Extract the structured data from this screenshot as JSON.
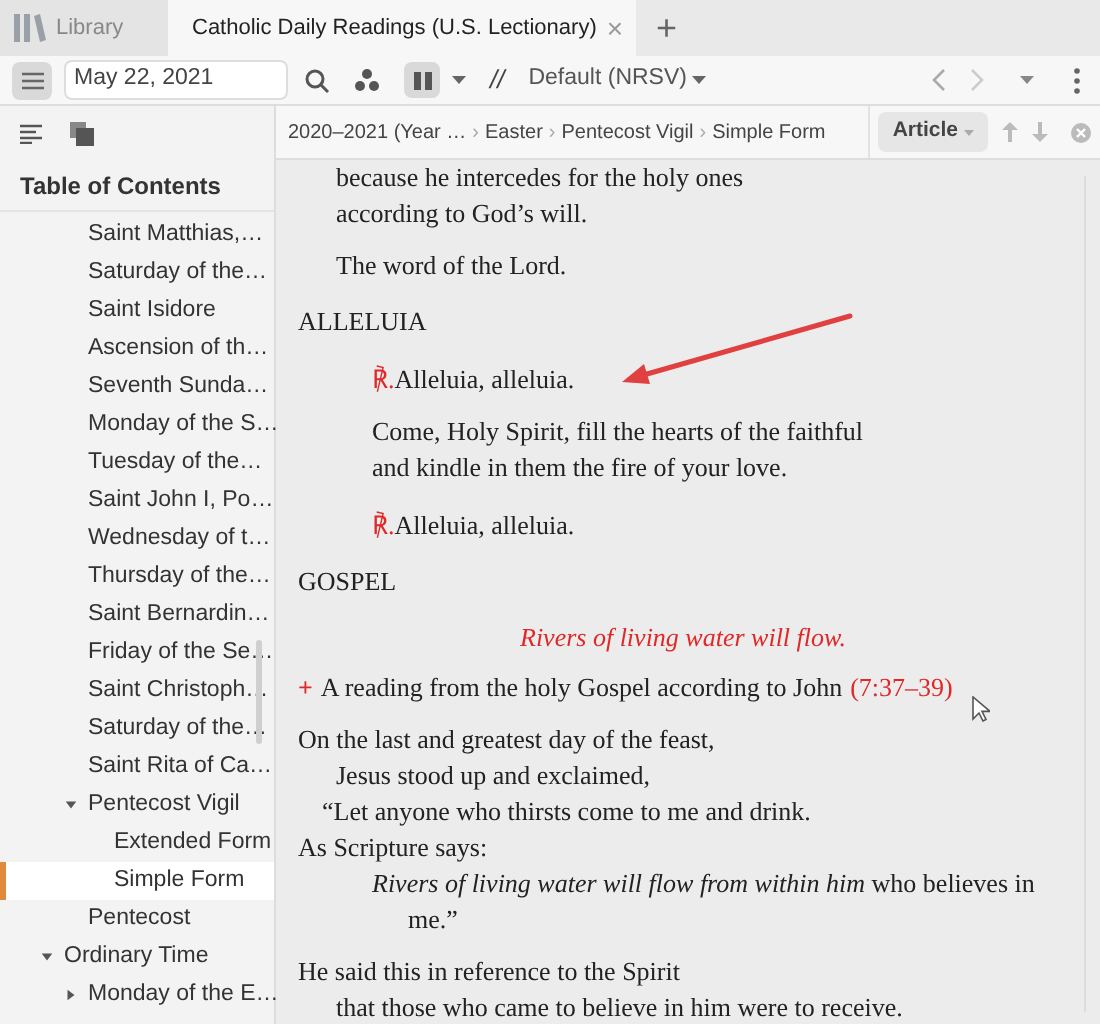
{
  "tabs": [
    {
      "label": "Library",
      "selected": false
    },
    {
      "label": "Catholic Daily Readings (U.S. Lectionary)",
      "selected": true,
      "close_glyph": "×"
    }
  ],
  "new_tab": "+",
  "toolbar": {
    "date": "May 22, 2021",
    "separator": "//",
    "version": "Default (NRSV)"
  },
  "breadcrumb": [
    {
      "label": "2020–2021 (Year …"
    },
    {
      "separator": "›",
      "label": "Easter"
    },
    {
      "separator": "›",
      "label": "Pentecost Vigil"
    },
    {
      "separator": "›",
      "label": "Simple Form"
    }
  ],
  "view_menu": "Article",
  "toc": {
    "title": "Table of Contents",
    "continued_items": [
      {
        "label": "Saint Matthias,…",
        "selected": false
      },
      {
        "label": "Saturday of the…",
        "selected": false
      },
      {
        "label": "Saint Isidore",
        "selected": false
      },
      {
        "label": "Ascension of th…",
        "selected": false
      },
      {
        "label": "Seventh Sunda…",
        "selected": false
      },
      {
        "label": "Monday of the S…",
        "selected": false
      },
      {
        "label": "Tuesday of the…",
        "selected": false
      },
      {
        "label": "Saint John I, Po…",
        "selected": false
      },
      {
        "label": "Wednesday of t…",
        "selected": false
      },
      {
        "label": "Thursday of the…",
        "selected": false
      },
      {
        "label": "Saint Bernardin…",
        "selected": false
      },
      {
        "label": "Friday of the Se…",
        "selected": false
      },
      {
        "label": "Saint Christoph…",
        "selected": false
      },
      {
        "label": "Saturday of the…",
        "selected": false
      },
      {
        "label": "Saint Rita of Ca…",
        "selected": false
      },
      {
        "label": "Pentecost Vigil",
        "selected": false,
        "expanded": true,
        "children": [
          {
            "label": "Extended Form",
            "selected": false
          },
          {
            "label": "Simple Form",
            "selected": true
          }
        ]
      },
      {
        "label": "Pentecost",
        "selected": false
      }
    ],
    "items": [
      {
        "label": "Ordinary Time",
        "selected": false,
        "expanded": true,
        "children": [
          {
            "label": "Monday of the E…",
            "selected": false,
            "expanded": false
          }
        ]
      }
    ]
  },
  "reading": [
    {
      "kind": "para",
      "lines": [
        {
          "kind": "indent",
          "text": "because he intercedes for the holy ones"
        },
        {
          "kind": "indent",
          "text": "according to God’s will."
        }
      ]
    },
    {
      "kind": "para",
      "lines": [
        {
          "kind": "indent",
          "text": "The word of the Lord."
        }
      ]
    },
    {
      "kind": "heading",
      "lines": [
        {
          "kind": "flush",
          "text": "ALLELUIA"
        }
      ]
    },
    {
      "kind": "response",
      "symbol": "℟.",
      "lines": [
        {
          "kind": "deep",
          "text": "Alleluia, alleluia."
        }
      ]
    },
    {
      "kind": "para",
      "lines": [
        {
          "kind": "deep",
          "text": "Come, Holy Spirit, fill the hearts of the faithful"
        },
        {
          "kind": "deep",
          "text": "and kindle in them the fire of your love."
        }
      ]
    },
    {
      "kind": "response",
      "symbol": "℟.",
      "lines": [
        {
          "kind": "deep",
          "text": "Alleluia, alleluia."
        }
      ]
    },
    {
      "kind": "heading",
      "lines": [
        {
          "kind": "flush",
          "text": "GOSPEL"
        }
      ]
    },
    {
      "kind": "title",
      "lines": [
        {
          "kind": "flush",
          "text": "Rivers of living water will flow."
        }
      ]
    },
    {
      "kind": "intro",
      "symbol": "+",
      "citation": "(7:37–39)",
      "lines": [
        {
          "kind": "flush",
          "text": "A reading from the holy Gospel according to John"
        }
      ]
    },
    {
      "kind": "para",
      "lines": [
        {
          "kind": "flush",
          "text": "On the last and greatest day of the feast,"
        },
        {
          "kind": "indent",
          "text": "Jesus stood up and exclaimed,"
        },
        {
          "kind": "quote",
          "text": "“Let anyone who thirsts come to me and drink."
        },
        {
          "kind": "flush",
          "text": "As Scripture says:"
        },
        {
          "kind": "deep",
          "text": "*Rivers of living water will flow from within him* who believes in"
        },
        {
          "kind": "deeper",
          "text": "me.”"
        }
      ]
    },
    {
      "kind": "para",
      "lines": [
        {
          "kind": "flush",
          "text": "He said this in reference to the Spirit"
        },
        {
          "kind": "indent",
          "text": "that those who came to believe in him were to receive."
        }
      ]
    }
  ]
}
